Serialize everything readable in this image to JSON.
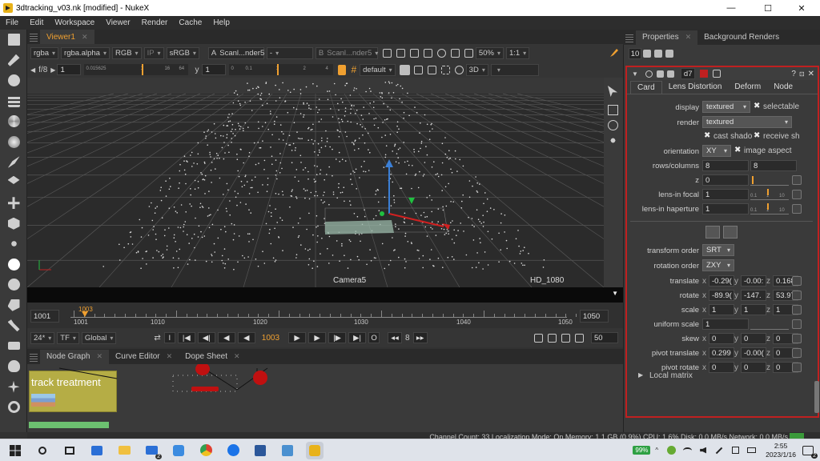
{
  "window": {
    "title": "3dtracking_v03.nk [modified] - NukeX"
  },
  "menubar": [
    "File",
    "Edit",
    "Workspace",
    "Viewer",
    "Render",
    "Cache",
    "Help"
  ],
  "viewer": {
    "tab": "Viewer1",
    "channels": "rgba",
    "alpha": "rgba.alpha",
    "display": "RGB",
    "ip": "IP",
    "colorspace": "sRGB",
    "input_a_label": "A",
    "input_a": "Scanl...nder5",
    "compare": "-",
    "input_b_label": "B",
    "input_b": "Scanl...nder5",
    "zoom": "50%",
    "ratio": "1:1",
    "fstop": "f/8",
    "gain": "1",
    "ruler_labels": [
      "0.015625",
      "1",
      "16",
      "64"
    ],
    "gamma_label": "y",
    "gamma": "1",
    "gamma_ruler": [
      "0",
      "0.1",
      "1",
      "2",
      "4"
    ],
    "view_default": "default",
    "view_mode": "3D",
    "camera_label": "Camera5",
    "format_label": "HD_1080"
  },
  "timeline": {
    "start": "1001",
    "end": "1050",
    "ticks": [
      "1001",
      "1010",
      "1020",
      "1030",
      "1040",
      "1050"
    ],
    "current_marker": "1003",
    "fps": "24*",
    "tf": "TF",
    "global": "Global",
    "frame": "1003",
    "step": "8",
    "end_frame": "50",
    "o_label": "O",
    "i_label": "I"
  },
  "node_graph": {
    "tabs": [
      "Node Graph",
      "Curve Editor",
      "Dope Sheet"
    ],
    "backdrop_label": "track treatment"
  },
  "properties": {
    "tabs": [
      "Properties",
      "Background Renders"
    ],
    "max_panels": "10",
    "node_name": "d7",
    "inner_tabs": [
      "Card",
      "Lens Distortion",
      "Deform",
      "Node"
    ],
    "display_label": "display",
    "display_value": "textured",
    "selectable_label": "selectable",
    "render_label": "render",
    "render_value": "textured",
    "cast_shadow_label": "cast shado",
    "receive_shadow_label": "receive sh",
    "orientation_label": "orientation",
    "orientation_value": "XY",
    "image_aspect_label": "image aspect",
    "rows_columns_label": "rows/columns",
    "rows": "8",
    "columns": "8",
    "z_label": "z",
    "z_value": "0",
    "lens_focal_label": "lens-in focal",
    "lens_focal_value": "1",
    "lens_aperture_label": "lens-in haperture",
    "lens_aperture_value": "1",
    "slider_marks": [
      "0.1",
      "1",
      "10"
    ],
    "transform_order_label": "transform order",
    "transform_order_value": "SRT",
    "rotation_order_label": "rotation order",
    "rotation_order_value": "ZXY",
    "translate_label": "translate",
    "translate": {
      "x": "-0.29(",
      "y": "-0.00:",
      "z": "0.168"
    },
    "rotate_label": "rotate",
    "rotate": {
      "x": "-89.9(",
      "y": "-147.",
      "z": "53.97"
    },
    "scale_label": "scale",
    "scale": {
      "x": "1",
      "y": "1",
      "z": "1"
    },
    "uniform_scale_label": "uniform scale",
    "uniform_scale": "1",
    "skew_label": "skew",
    "skew": {
      "x": "0",
      "y": "0",
      "z": "0"
    },
    "pivot_translate_label": "pivot translate",
    "pivot_translate": {
      "x": "0.299",
      "y": "-0.00(",
      "z": "0"
    },
    "pivot_rotate_label": "pivot rotate",
    "pivot_rotate": {
      "x": "0",
      "y": "0",
      "z": "0"
    },
    "local_matrix_label": "Local matrix",
    "axis_x": "x",
    "axis_y": "y",
    "axis_z": "z"
  },
  "status": "Channel Count: 33  Localization Mode: On  Memory: 1.1 GB (0.9%)  CPU: 1.6%  Disk: 0.0 MB/s  Network: 0.0 MB/s",
  "taskbar": {
    "battery": "99%",
    "time": "2:55",
    "date": "2023/1/16",
    "mail_badge": "2",
    "notif_badge": "2"
  },
  "colors": {
    "accent": "#f0a030",
    "props_border": "#c02020",
    "backdrop": "#b5ad45"
  }
}
